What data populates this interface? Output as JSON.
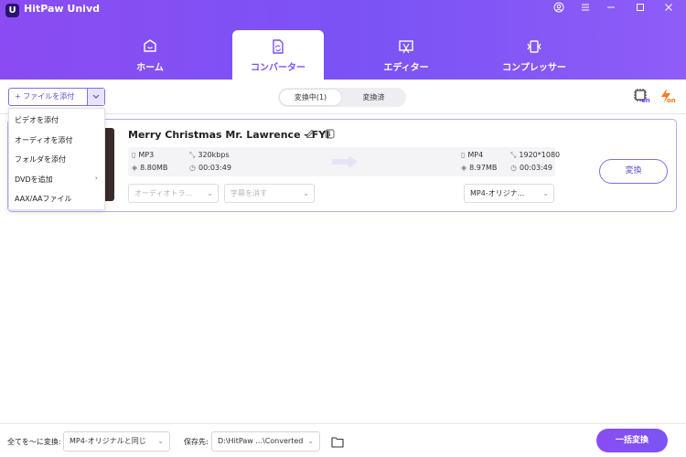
{
  "app": {
    "logo_letter": "U",
    "title": "HitPaw Univd",
    "window_controls": [
      "account-icon",
      "menu-icon",
      "minimize-icon",
      "maximize-icon",
      "close-icon"
    ]
  },
  "nav": {
    "tabs": [
      {
        "label": "ホーム",
        "icon": "home-icon",
        "active": false
      },
      {
        "label": "コンバーター",
        "icon": "converter-icon",
        "active": true
      },
      {
        "label": "エディター",
        "icon": "editor-icon",
        "active": false
      },
      {
        "label": "コンプレッサー",
        "icon": "compressor-icon",
        "active": false
      }
    ]
  },
  "toolbar": {
    "add_file_label": "+ ファイルを添付",
    "segment": {
      "converting": "変換中(1)",
      "converted": "変換済"
    },
    "hw_accel_label": "on",
    "fast_label": "on"
  },
  "add_menu": {
    "items": [
      "ビデオを添付",
      "オーディオを添付",
      "フォルダを添付",
      "DVDを追加",
      "AAX/AAファイル"
    ]
  },
  "file": {
    "title": "Merry Christmas Mr. Lawrence - FYI",
    "source": {
      "format": "MP3",
      "bitrate": "320kbps",
      "size": "8.80MB",
      "duration": "00:03:49"
    },
    "target": {
      "format": "MP4",
      "resolution": "1920*1080",
      "size": "8.97MB",
      "duration": "00:03:49"
    },
    "convert_label": "変換",
    "audio_track_placeholder": "オーディオトラ...",
    "subtitle_placeholder": "字幕を消す",
    "output_format": "MP4-オリジナ..."
  },
  "footer": {
    "convert_all_label": "全てを～に変換:",
    "convert_all_value": "MP4-オリジナルと同じ",
    "save_to_label": "保存先:",
    "save_to_value": "D:\\HitPaw ...\\Converted",
    "batch_convert_label": "一括変換"
  },
  "colors": {
    "accent": "#7c4dff",
    "header_start": "#8a4cf2",
    "header_end": "#8f5cf7"
  }
}
